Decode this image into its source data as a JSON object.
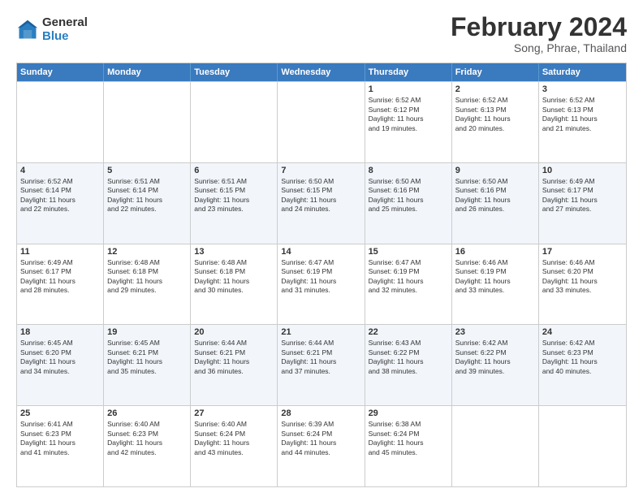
{
  "logo": {
    "general": "General",
    "blue": "Blue"
  },
  "title": "February 2024",
  "subtitle": "Song, Phrae, Thailand",
  "header_days": [
    "Sunday",
    "Monday",
    "Tuesday",
    "Wednesday",
    "Thursday",
    "Friday",
    "Saturday"
  ],
  "weeks": [
    [
      {
        "day": "",
        "info": ""
      },
      {
        "day": "",
        "info": ""
      },
      {
        "day": "",
        "info": ""
      },
      {
        "day": "",
        "info": ""
      },
      {
        "day": "1",
        "info": "Sunrise: 6:52 AM\nSunset: 6:12 PM\nDaylight: 11 hours\nand 19 minutes."
      },
      {
        "day": "2",
        "info": "Sunrise: 6:52 AM\nSunset: 6:13 PM\nDaylight: 11 hours\nand 20 minutes."
      },
      {
        "day": "3",
        "info": "Sunrise: 6:52 AM\nSunset: 6:13 PM\nDaylight: 11 hours\nand 21 minutes."
      }
    ],
    [
      {
        "day": "4",
        "info": "Sunrise: 6:52 AM\nSunset: 6:14 PM\nDaylight: 11 hours\nand 22 minutes."
      },
      {
        "day": "5",
        "info": "Sunrise: 6:51 AM\nSunset: 6:14 PM\nDaylight: 11 hours\nand 22 minutes."
      },
      {
        "day": "6",
        "info": "Sunrise: 6:51 AM\nSunset: 6:15 PM\nDaylight: 11 hours\nand 23 minutes."
      },
      {
        "day": "7",
        "info": "Sunrise: 6:50 AM\nSunset: 6:15 PM\nDaylight: 11 hours\nand 24 minutes."
      },
      {
        "day": "8",
        "info": "Sunrise: 6:50 AM\nSunset: 6:16 PM\nDaylight: 11 hours\nand 25 minutes."
      },
      {
        "day": "9",
        "info": "Sunrise: 6:50 AM\nSunset: 6:16 PM\nDaylight: 11 hours\nand 26 minutes."
      },
      {
        "day": "10",
        "info": "Sunrise: 6:49 AM\nSunset: 6:17 PM\nDaylight: 11 hours\nand 27 minutes."
      }
    ],
    [
      {
        "day": "11",
        "info": "Sunrise: 6:49 AM\nSunset: 6:17 PM\nDaylight: 11 hours\nand 28 minutes."
      },
      {
        "day": "12",
        "info": "Sunrise: 6:48 AM\nSunset: 6:18 PM\nDaylight: 11 hours\nand 29 minutes."
      },
      {
        "day": "13",
        "info": "Sunrise: 6:48 AM\nSunset: 6:18 PM\nDaylight: 11 hours\nand 30 minutes."
      },
      {
        "day": "14",
        "info": "Sunrise: 6:47 AM\nSunset: 6:19 PM\nDaylight: 11 hours\nand 31 minutes."
      },
      {
        "day": "15",
        "info": "Sunrise: 6:47 AM\nSunset: 6:19 PM\nDaylight: 11 hours\nand 32 minutes."
      },
      {
        "day": "16",
        "info": "Sunrise: 6:46 AM\nSunset: 6:19 PM\nDaylight: 11 hours\nand 33 minutes."
      },
      {
        "day": "17",
        "info": "Sunrise: 6:46 AM\nSunset: 6:20 PM\nDaylight: 11 hours\nand 33 minutes."
      }
    ],
    [
      {
        "day": "18",
        "info": "Sunrise: 6:45 AM\nSunset: 6:20 PM\nDaylight: 11 hours\nand 34 minutes."
      },
      {
        "day": "19",
        "info": "Sunrise: 6:45 AM\nSunset: 6:21 PM\nDaylight: 11 hours\nand 35 minutes."
      },
      {
        "day": "20",
        "info": "Sunrise: 6:44 AM\nSunset: 6:21 PM\nDaylight: 11 hours\nand 36 minutes."
      },
      {
        "day": "21",
        "info": "Sunrise: 6:44 AM\nSunset: 6:21 PM\nDaylight: 11 hours\nand 37 minutes."
      },
      {
        "day": "22",
        "info": "Sunrise: 6:43 AM\nSunset: 6:22 PM\nDaylight: 11 hours\nand 38 minutes."
      },
      {
        "day": "23",
        "info": "Sunrise: 6:42 AM\nSunset: 6:22 PM\nDaylight: 11 hours\nand 39 minutes."
      },
      {
        "day": "24",
        "info": "Sunrise: 6:42 AM\nSunset: 6:23 PM\nDaylight: 11 hours\nand 40 minutes."
      }
    ],
    [
      {
        "day": "25",
        "info": "Sunrise: 6:41 AM\nSunset: 6:23 PM\nDaylight: 11 hours\nand 41 minutes."
      },
      {
        "day": "26",
        "info": "Sunrise: 6:40 AM\nSunset: 6:23 PM\nDaylight: 11 hours\nand 42 minutes."
      },
      {
        "day": "27",
        "info": "Sunrise: 6:40 AM\nSunset: 6:24 PM\nDaylight: 11 hours\nand 43 minutes."
      },
      {
        "day": "28",
        "info": "Sunrise: 6:39 AM\nSunset: 6:24 PM\nDaylight: 11 hours\nand 44 minutes."
      },
      {
        "day": "29",
        "info": "Sunrise: 6:38 AM\nSunset: 6:24 PM\nDaylight: 11 hours\nand 45 minutes."
      },
      {
        "day": "",
        "info": ""
      },
      {
        "day": "",
        "info": ""
      }
    ]
  ]
}
